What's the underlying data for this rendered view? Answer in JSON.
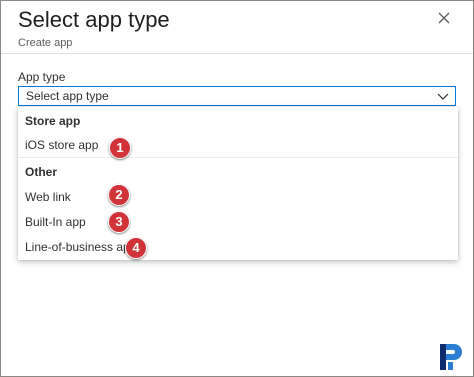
{
  "header": {
    "title": "Select app type",
    "subtitle": "Create app"
  },
  "field": {
    "label": "App type",
    "placeholder": "Select app type"
  },
  "dropdown": {
    "groups": [
      {
        "header": "Store app",
        "options": [
          "iOS store app"
        ]
      },
      {
        "header": "Other",
        "options": [
          "Web link",
          "Built-In app",
          "Line-of-business app"
        ]
      }
    ]
  },
  "badges": [
    "1",
    "2",
    "3",
    "4"
  ],
  "colors": {
    "accent": "#0078d4",
    "badge": "#d13438",
    "logo_dark": "#0e2c6b",
    "logo_light": "#2b7cd3"
  },
  "icons": {
    "close": "close-icon",
    "chevron": "chevron-down-icon",
    "logo": "p-logo-icon"
  }
}
